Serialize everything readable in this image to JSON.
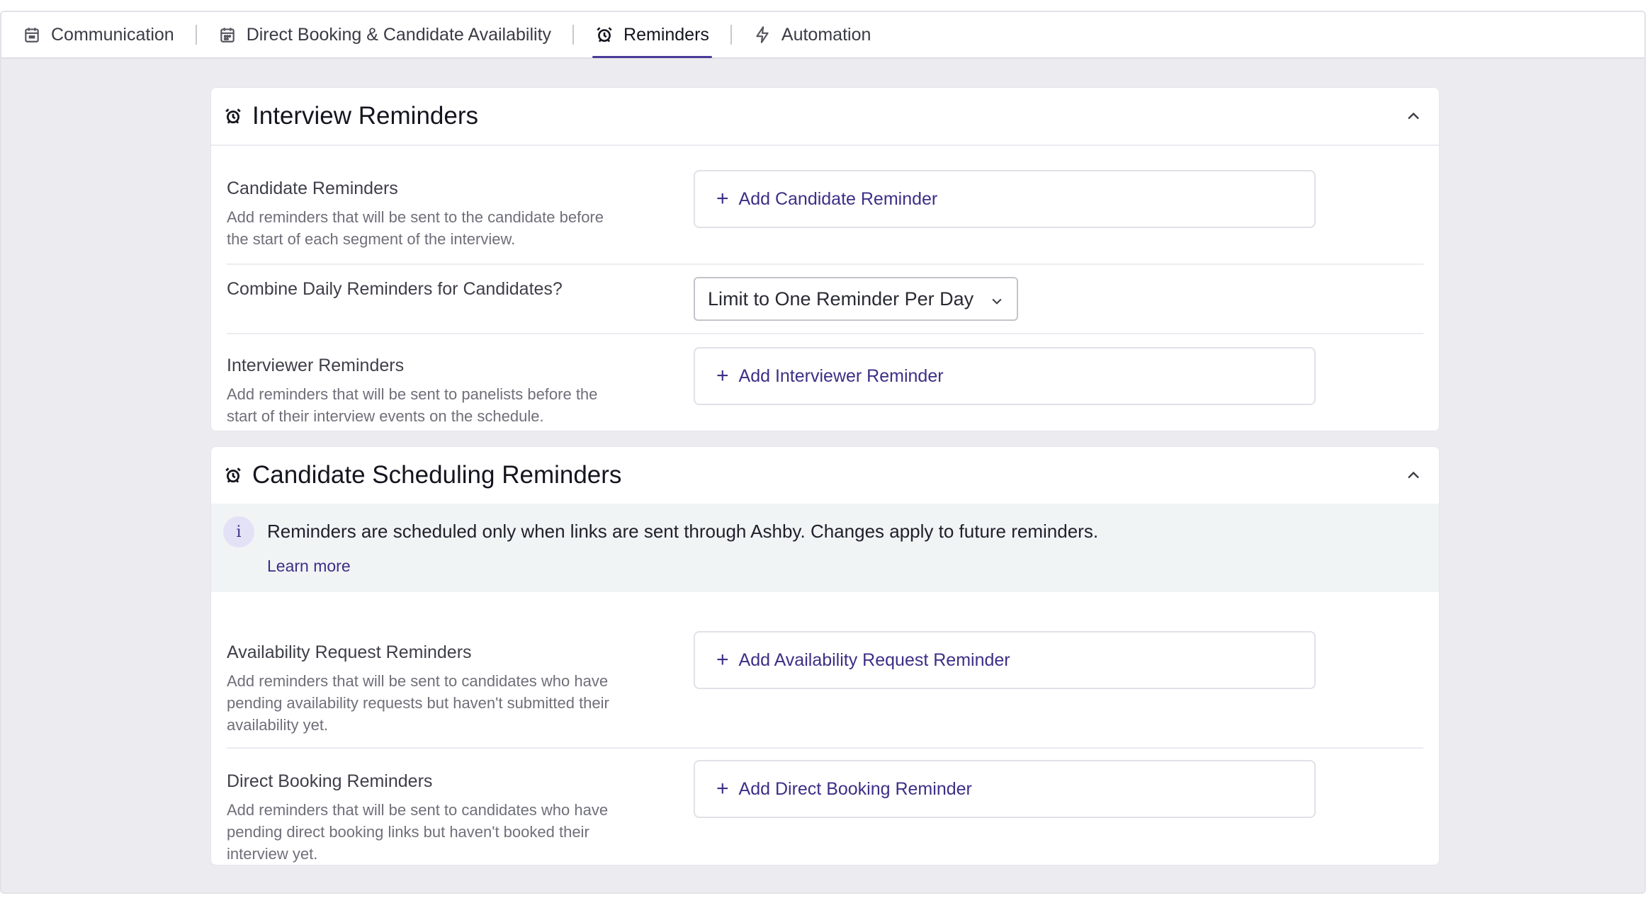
{
  "tabs": [
    {
      "label": "Communication",
      "icon": "calendar-check-icon"
    },
    {
      "label": "Direct Booking & Candidate Availability",
      "icon": "calendar-icon"
    },
    {
      "label": "Reminders",
      "icon": "alarm-clock-icon",
      "active": true
    },
    {
      "label": "Automation",
      "icon": "lightning-icon"
    }
  ],
  "interview_reminders": {
    "title": "Interview Reminders",
    "candidate": {
      "label": "Candidate Reminders",
      "description": "Add reminders that will be sent to the candidate before the start of each segment of the interview.",
      "button": "Add Candidate Reminder"
    },
    "combine": {
      "label": "Combine Daily Reminders for Candidates?",
      "selected": "Limit to One Reminder Per Day"
    },
    "interviewer": {
      "label": "Interviewer Reminders",
      "description": "Add reminders that will be sent to panelists before the start of their interview events on the schedule.",
      "button": "Add Interviewer Reminder"
    }
  },
  "scheduling_reminders": {
    "title": "Candidate Scheduling Reminders",
    "banner": {
      "text": "Reminders are scheduled only when links are sent through Ashby. Changes apply to future reminders.",
      "link": "Learn more"
    },
    "availability": {
      "label": "Availability Request Reminders",
      "description": "Add reminders that will be sent to candidates who have pending availability requests but haven't submitted their availability yet.",
      "button": "Add Availability Request Reminder"
    },
    "direct_booking": {
      "label": "Direct Booking Reminders",
      "description": "Add reminders that will be sent to candidates who have pending direct booking links but haven't booked their interview yet.",
      "button": "Add Direct Booking Reminder"
    }
  },
  "colors": {
    "accent": "#4c3a99",
    "link": "#3d2f86",
    "banner_bg": "#f0f4f5"
  }
}
